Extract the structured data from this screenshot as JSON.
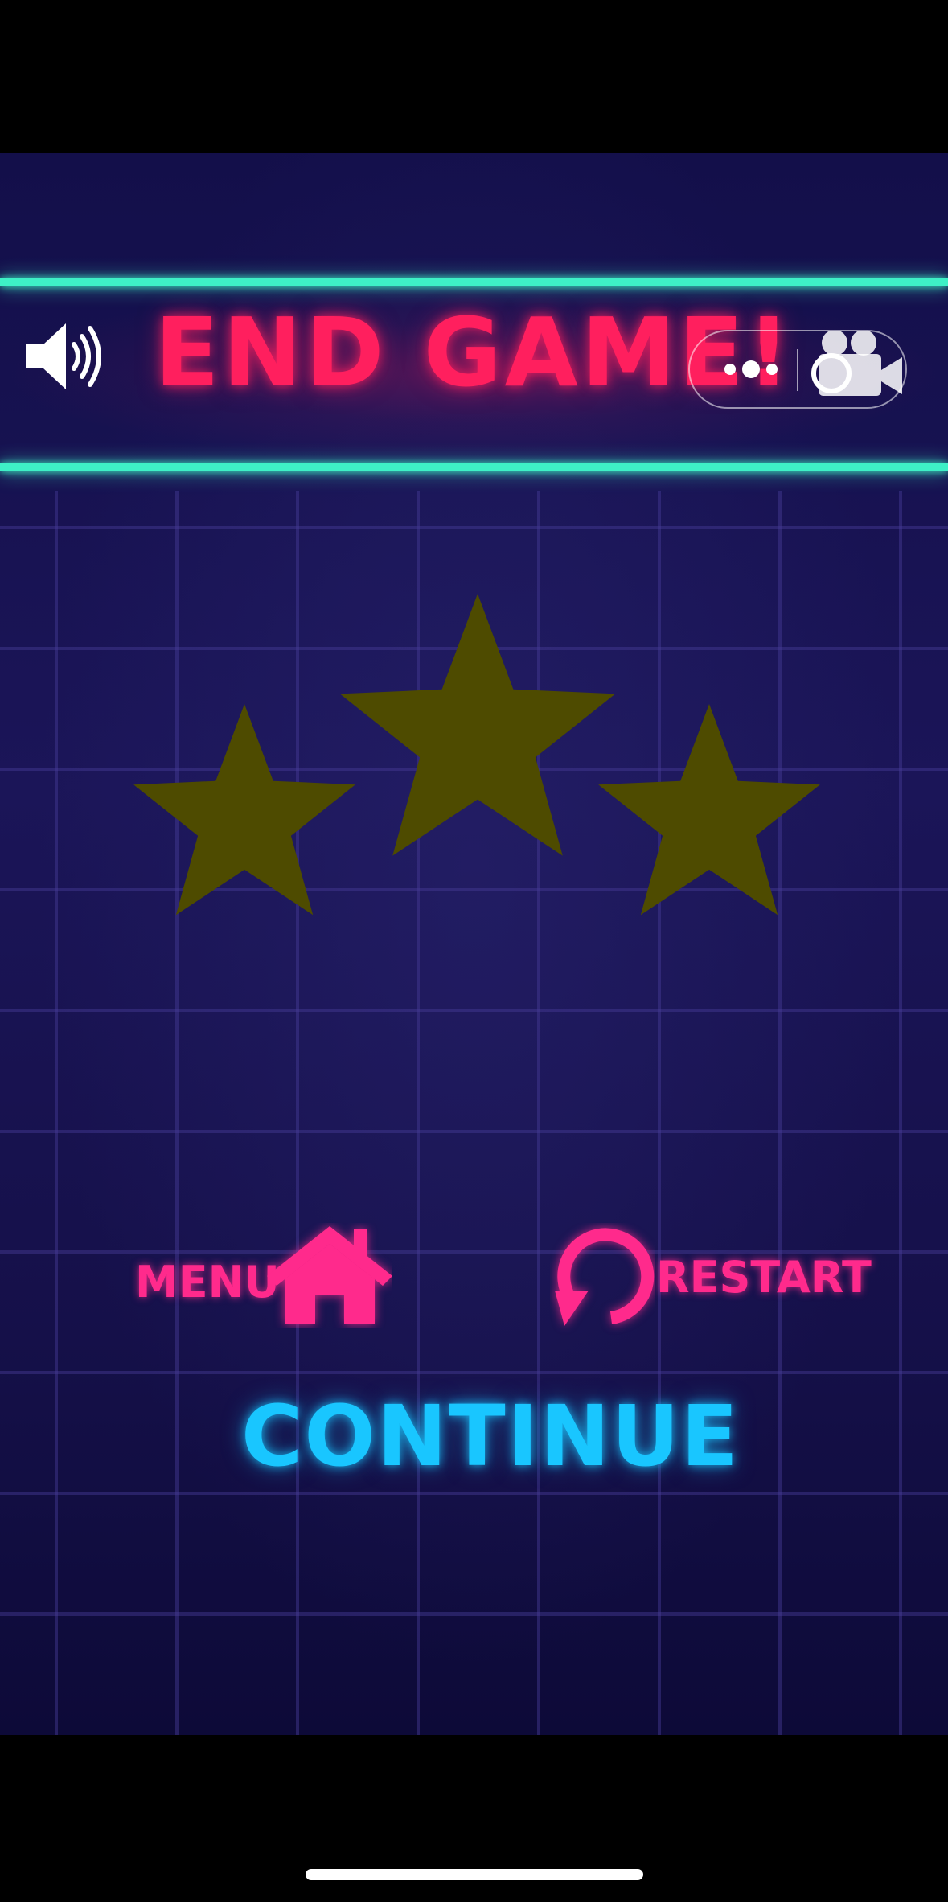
{
  "game": {
    "title": "END GAME!",
    "sound_icon": "speaker-volume-icon",
    "stars": {
      "earned": 3,
      "total": 3,
      "fill_color": "#4e4b00"
    },
    "buttons": {
      "menu_label": "MENU",
      "menu_icon": "home-icon",
      "restart_label": "RESTART",
      "restart_icon": "restart-arrow-icon",
      "continue_label": "CONTINUE"
    },
    "colors": {
      "title": "#ff1f5e",
      "accent_pink": "#ff2a8c",
      "accent_cyan": "#19c6ff",
      "neon_line": "#3ef0c6",
      "background": "#1b1558"
    }
  },
  "mini_program_capsule": {
    "more_icon": "more-dots-icon",
    "record_icon": "video-camera-icon"
  }
}
